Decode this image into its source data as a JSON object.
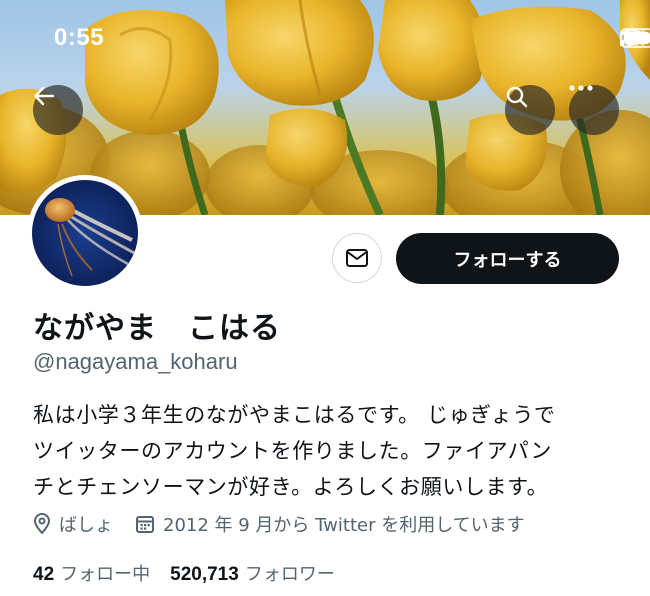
{
  "status_bar": {
    "time": "0:55"
  },
  "header": {
    "back_icon": "arrow-left-icon",
    "search_icon": "search-icon",
    "more_icon": "more-horizontal-icon"
  },
  "profile": {
    "display_name": "ながやま　こはる",
    "handle": "@nagayama_koharu",
    "bio_lines": [
      "私は小学３年生のながやまこはるです。 じゅぎょうで",
      "ツイッターのアカウントを作りました。ファイアパン",
      "チとチェンソーマンが好き。よろしくお願いします。"
    ],
    "location": "ばしょ",
    "joined": "2012 年 9 月から Twitter を利用しています"
  },
  "actions": {
    "follow_label": "フォローする",
    "message_icon": "mail-icon"
  },
  "stats": {
    "following_count": "42",
    "following_label": "フォロー中",
    "followers_count": "520,713",
    "followers_label": "フォロワー"
  },
  "colors": {
    "follow_button_bg": "#0f1419",
    "secondary_text": "#536471",
    "primary_text": "#0f1419"
  }
}
